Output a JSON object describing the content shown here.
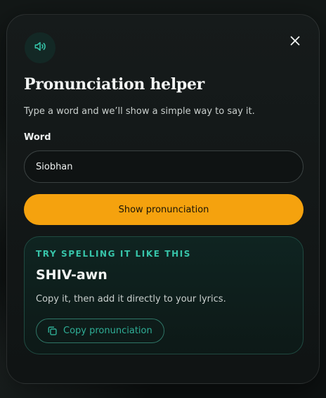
{
  "dialog": {
    "title": "Pronunciation helper",
    "subtitle": "Type a word and we’ll show a simple way to say it.",
    "icon": "speaker-icon",
    "close_icon": "close-icon"
  },
  "form": {
    "label": "Word",
    "value": "Siobhan",
    "submit_label": "Show pronunciation"
  },
  "result": {
    "eyebrow": "TRY SPELLING IT LIKE THIS",
    "pronunciation": "SHIV-awn",
    "hint": "Copy it, then add it directly to your lyrics.",
    "copy_label": "Copy pronunciation",
    "copy_icon": "copy-icon"
  },
  "colors": {
    "accent": "#f5a20e",
    "teal": "#37c4a9",
    "background": "#111515"
  }
}
